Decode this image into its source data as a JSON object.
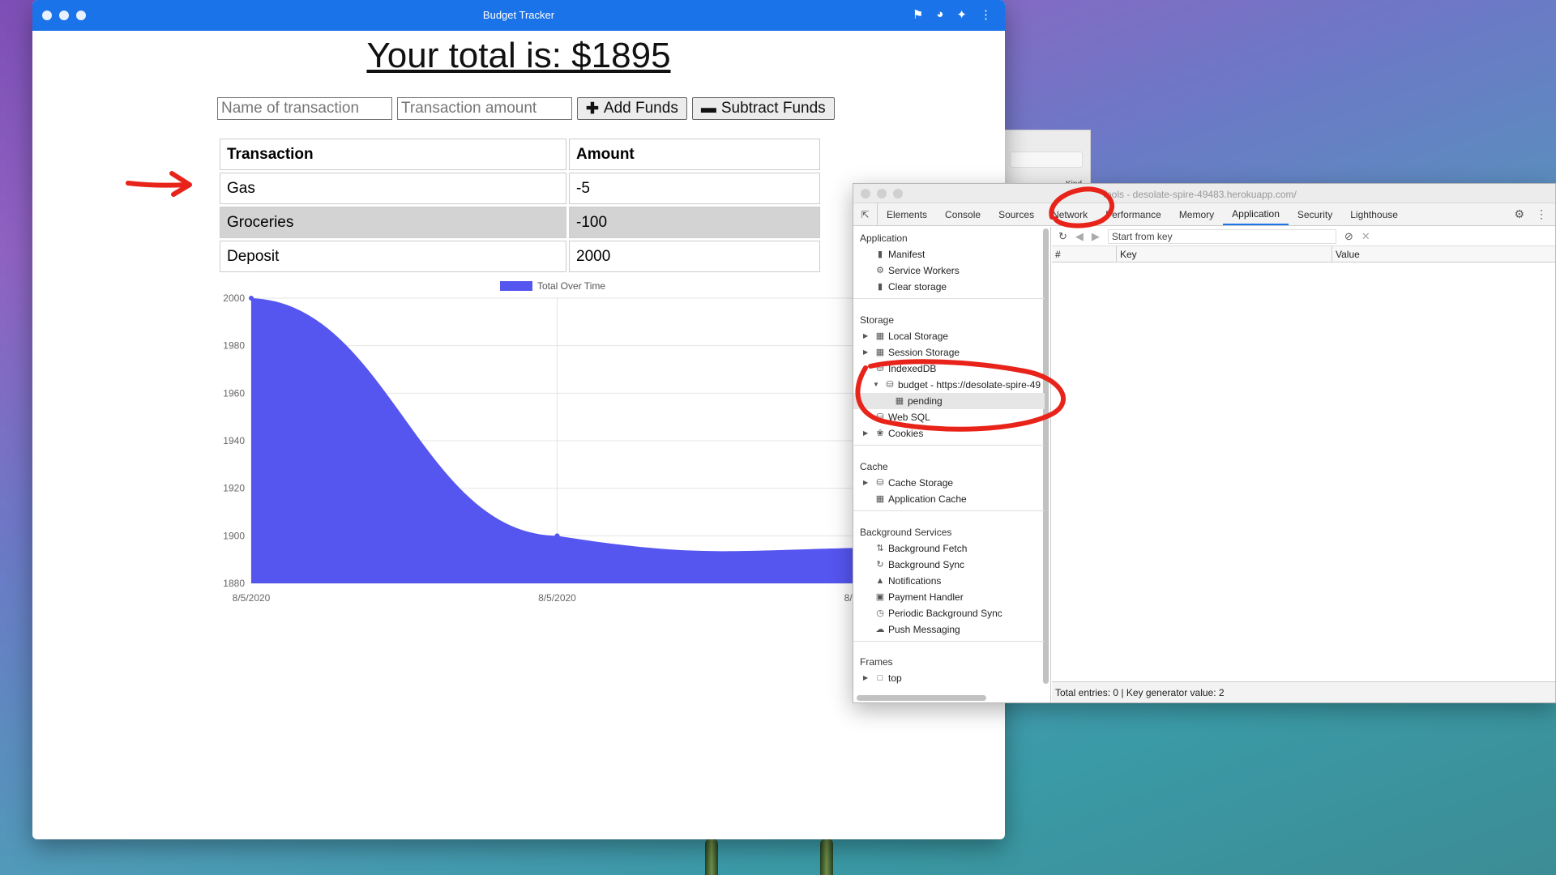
{
  "browser": {
    "title": "Budget Tracker",
    "total_text": "Your total is: $1895",
    "name_placeholder": "Name of transaction",
    "amount_placeholder": "Transaction amount",
    "add_label": "Add Funds",
    "subtract_label": "Subtract Funds",
    "table": {
      "headers": [
        "Transaction",
        "Amount"
      ],
      "rows": [
        {
          "name": "Gas",
          "amount": "-5"
        },
        {
          "name": "Groceries",
          "amount": "-100"
        },
        {
          "name": "Deposit",
          "amount": "2000"
        }
      ]
    }
  },
  "chart_data": {
    "type": "area",
    "title": "",
    "legend": [
      {
        "label": "Total Over Time",
        "color": "#5555f0"
      }
    ],
    "x": [
      "8/5/2020",
      "8/5/2020",
      "8/5/2020"
    ],
    "series": [
      {
        "name": "Total Over Time",
        "values": [
          2000,
          1900,
          1895
        ]
      }
    ],
    "ylim": [
      1880,
      2000
    ],
    "yticks": [
      2000,
      1980,
      1960,
      1940,
      1920,
      1900,
      1880
    ],
    "grid": true,
    "legend_position": "top"
  },
  "devtools": {
    "title": "Tools - desolate-spire-49483.herokuapp.com/",
    "tabs": [
      "Elements",
      "Console",
      "Sources",
      "Network",
      "Performance",
      "Memory",
      "Application",
      "Security",
      "Lighthouse"
    ],
    "active_tab": "Application",
    "sidebar": {
      "application_header": "Application",
      "application_items": [
        "Manifest",
        "Service Workers",
        "Clear storage"
      ],
      "storage_header": "Storage",
      "storage_items": [
        "Local Storage",
        "Session Storage",
        "IndexedDB",
        "budget - https://desolate-spire-49",
        "pending",
        "Web SQL",
        "Cookies"
      ],
      "cache_header": "Cache",
      "cache_items": [
        "Cache Storage",
        "Application Cache"
      ],
      "bg_header": "Background Services",
      "bg_items": [
        "Background Fetch",
        "Background Sync",
        "Notifications",
        "Payment Handler",
        "Periodic Background Sync",
        "Push Messaging"
      ],
      "frames_header": "Frames",
      "frames_items": [
        "top"
      ]
    },
    "key_placeholder": "Start from key",
    "columns": [
      "#",
      "Key",
      "Value"
    ],
    "footer": "Total entries: 0 | Key generator value: 2"
  },
  "behind_window": {
    "kind_label": "Kind"
  },
  "colors": {
    "accent": "#1a73e8",
    "chart_fill": "#5555f0",
    "annotation": "#e8231a"
  }
}
